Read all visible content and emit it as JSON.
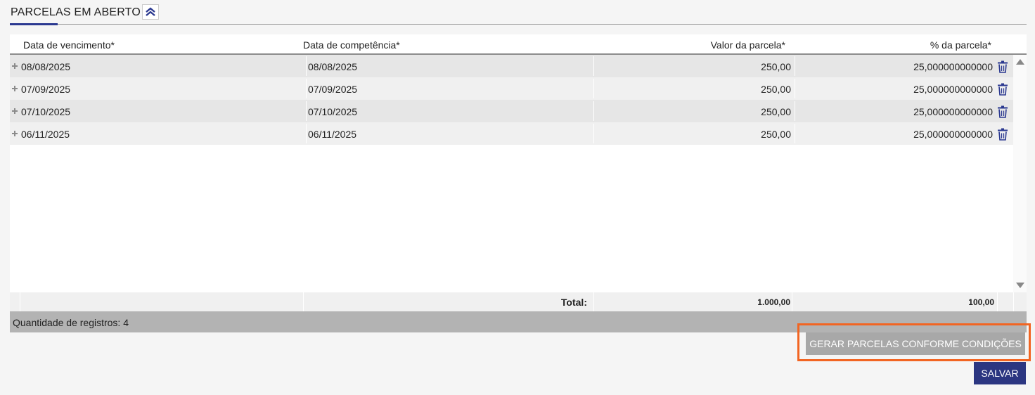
{
  "section": {
    "title": "PARCELAS EM ABERTO",
    "collapse_icon": "chevron-double-up-icon"
  },
  "grid": {
    "columns": [
      "Data de vencimento*",
      "Data de competência*",
      "Valor da parcela*",
      "% da parcela*"
    ],
    "rows": [
      {
        "vencimento": "08/08/2025",
        "competencia": "08/08/2025",
        "valor": "250,00",
        "percentual": "25,000000000000"
      },
      {
        "vencimento": "07/09/2025",
        "competencia": "07/09/2025",
        "valor": "250,00",
        "percentual": "25,000000000000"
      },
      {
        "vencimento": "07/10/2025",
        "competencia": "07/10/2025",
        "valor": "250,00",
        "percentual": "25,000000000000"
      },
      {
        "vencimento": "06/11/2025",
        "competencia": "06/11/2025",
        "valor": "250,00",
        "percentual": "25,000000000000"
      }
    ],
    "footer": {
      "total_label": "Total:",
      "valor_total": "1.000,00",
      "percentual_total": "100,00"
    },
    "record_count": "Quantidade de registros: 4"
  },
  "actions": {
    "generate_label": "GERAR PARCELAS CONFORME CONDIÇÕES",
    "save_label": "SALVAR"
  },
  "colors": {
    "accent": "#2b3990",
    "highlight": "#f26522",
    "save": "#2b3681"
  }
}
